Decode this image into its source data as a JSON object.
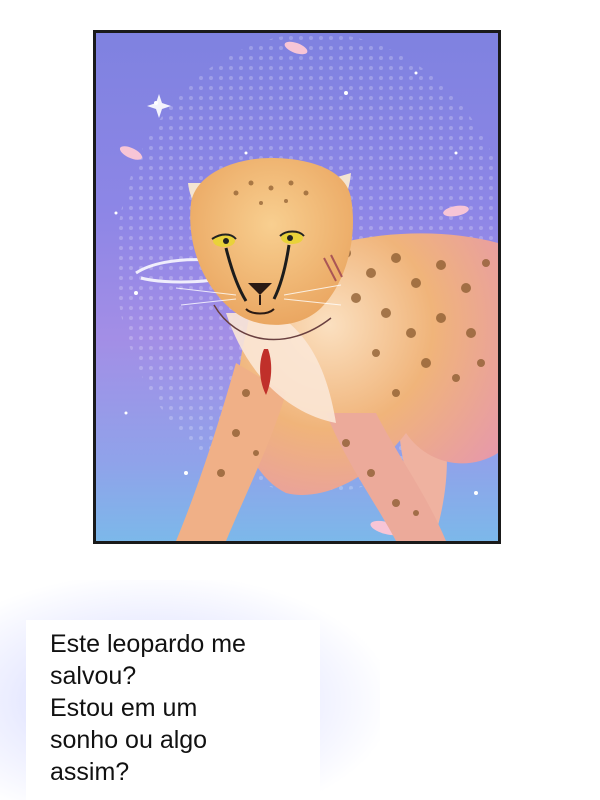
{
  "caption": {
    "lines": [
      "Este leopardo me",
      "salvou?",
      "Estou em um",
      "sonho ou algo",
      "assim?"
    ]
  },
  "colors": {
    "panel_border": "#1a1a1a",
    "sky_top": "#7f82e0",
    "sky_bottom": "#7cb8ea",
    "fur": "#f0b46a",
    "spots": "#8a5a2e",
    "eyes": "#e9d23a",
    "pendant": "#c0302a"
  },
  "illustration": {
    "subject": "cheetah",
    "accessory": "red-pendant-necklace"
  }
}
